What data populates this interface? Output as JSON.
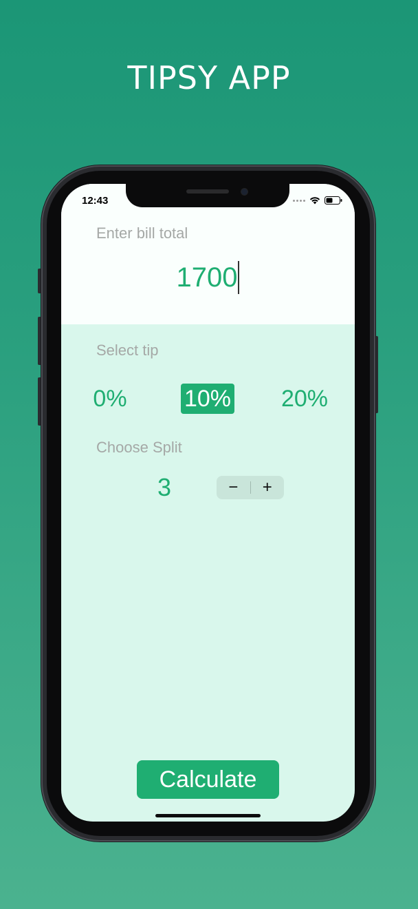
{
  "header": {
    "title": "TIPSY APP"
  },
  "status_bar": {
    "time": "12:43"
  },
  "bill": {
    "label": "Enter bill total",
    "value": "1700"
  },
  "tip": {
    "label": "Select tip",
    "options": [
      "0%",
      "10%",
      "20%"
    ],
    "selected": "10%"
  },
  "split": {
    "label": "Choose Split",
    "value": "3",
    "minus": "−",
    "plus": "+"
  },
  "action": {
    "calculate_label": "Calculate"
  },
  "colors": {
    "accent": "#1fae72",
    "background_top": "#1b9676",
    "background_bottom": "#4bb28f",
    "panel": "#d9f7ec"
  }
}
